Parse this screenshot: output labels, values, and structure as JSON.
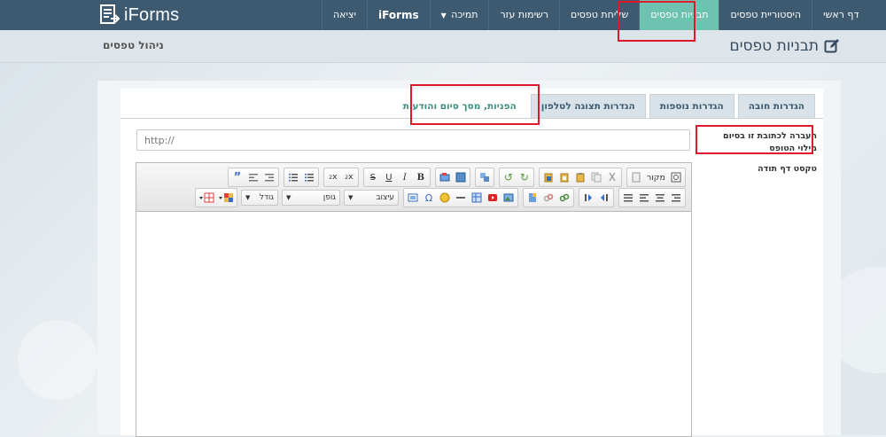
{
  "app": {
    "logo_text": "iForms"
  },
  "nav": {
    "items": [
      {
        "label": "דף ראשי",
        "name": "nav-home",
        "active": false
      },
      {
        "label": "היסטוריית טפסים",
        "name": "nav-forms-history",
        "active": false
      },
      {
        "label": "תבניות טפסים",
        "name": "nav-form-templates",
        "active": true
      },
      {
        "label": "שליחת טפסים",
        "name": "nav-send-forms",
        "active": false
      },
      {
        "label": "רשימות עזר",
        "name": "nav-helper-lists",
        "active": false
      },
      {
        "label": "תמיכה",
        "name": "nav-support",
        "active": false,
        "dropdown": true
      },
      {
        "label": "iForms",
        "name": "nav-iforms",
        "active": false,
        "bold": true
      },
      {
        "label": "יציאה",
        "name": "nav-logout",
        "active": false
      }
    ],
    "active_color": "#6dc2b0"
  },
  "header": {
    "page_title": "תבניות טפסים",
    "manage_link": "ניהול טפסים"
  },
  "tabs": [
    {
      "label": "הגדרות חובה",
      "active": false
    },
    {
      "label": "הגדרות נוספות",
      "active": false
    },
    {
      "label": "הגדרות תצוגה לטלפון",
      "active": false
    },
    {
      "label": "הפניות, מסך סיום והודעות",
      "active": true
    }
  ],
  "side_menu": {
    "redirect_label": "העברה לכתובת זו בסיום מילוי הטופס",
    "thanks_label": "טקסט דף תודה"
  },
  "url_field": {
    "placeholder": "http://",
    "value": ""
  },
  "editor": {
    "source_label": "מקור",
    "format_label": "עיצוב",
    "font_label": "גופן",
    "size_label": "גודל"
  },
  "colors": {
    "topbar": "#3d5a70",
    "highlight_red": "#e0182b"
  }
}
